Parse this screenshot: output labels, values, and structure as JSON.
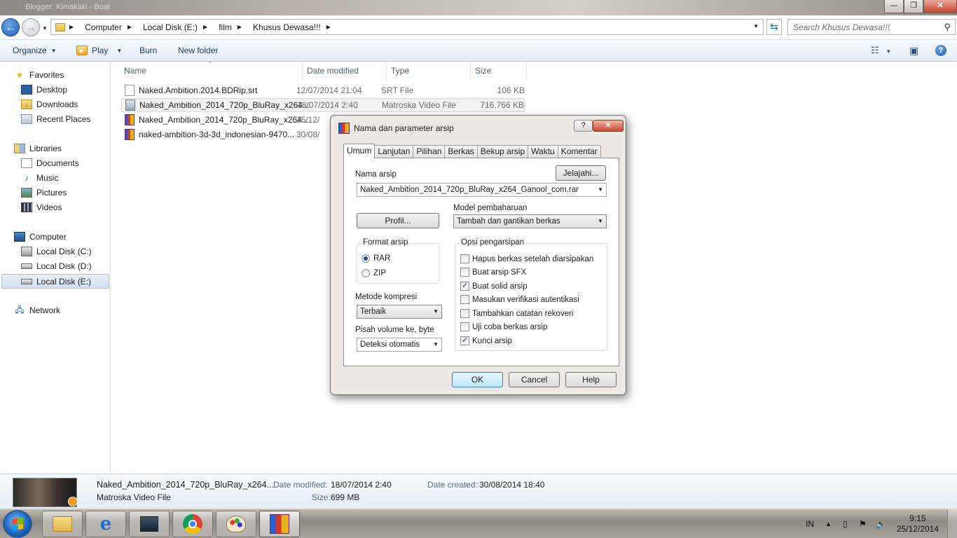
{
  "window": {
    "title_ghost": "Blogger: Kimakaki - Buat"
  },
  "address": {
    "crumbs": [
      "Computer",
      "Local Disk (E:)",
      "film",
      "Khusus Dewasa!!!"
    ],
    "search_placeholder": "Search Khusus Dewasa!!!"
  },
  "toolbar": {
    "organize": "Organize",
    "play": "Play",
    "burn": "Burn",
    "new_folder": "New folder"
  },
  "sidebar": {
    "favorites": "Favorites",
    "desktop": "Desktop",
    "downloads": "Downloads",
    "recent": "Recent Places",
    "libraries": "Libraries",
    "documents": "Documents",
    "music": "Music",
    "pictures": "Pictures",
    "videos": "Videos",
    "computer": "Computer",
    "disk_c": "Local Disk (C:)",
    "disk_d": "Local Disk (D:)",
    "disk_e": "Local Disk (E:)",
    "network": "Network"
  },
  "columns": {
    "name": "Name",
    "date": "Date modified",
    "type": "Type",
    "size": "Size"
  },
  "files": [
    {
      "name": "Naked.Ambition.2014.BDRip.srt",
      "date": "12/07/2014 21:04",
      "type": "SRT File",
      "size": "106 KB",
      "icon": "srt-file-icon"
    },
    {
      "name": "Naked_Ambition_2014_720p_BluRay_x264...",
      "date": "18/07/2014 2:40",
      "type": "Matroska Video File",
      "size": "716,766 KB",
      "icon": "video-file-icon"
    },
    {
      "name": "Naked_Ambition_2014_720p_BluRay_x264...",
      "date": "25/12/",
      "type": "",
      "size": "",
      "icon": "winrar-archive-icon"
    },
    {
      "name": "naked-ambition-3d-3d_indonesian-9470...",
      "date": "30/08/",
      "type": "",
      "size": "",
      "icon": "winrar-archive-icon"
    }
  ],
  "details": {
    "filename": "Naked_Ambition_2014_720p_BluRay_x264...",
    "filetype": "Matroska Video File",
    "modified_label": "Date modified:",
    "modified_value": "18/07/2014 2:40",
    "size_label": "Size:",
    "size_value": "699 MB",
    "created_label": "Date created:",
    "created_value": "30/08/2014 18:40"
  },
  "dialog": {
    "title": "Nama dan parameter arsip",
    "help_btn": "?",
    "tabs": [
      "Umum",
      "Lanjutan",
      "Pilihan",
      "Berkas",
      "Bekup arsip",
      "Waktu",
      "Komentar"
    ],
    "archive_name_label": "Nama arsip",
    "browse_btn": "Jelajahi...",
    "archive_name_value": "Naked_Ambition_2014_720p_BluRay_x264_Ganool_com.rar",
    "profile_btn": "Profil...",
    "update_mode_label": "Model pembaharuan",
    "update_mode_value": "Tambah dan gantikan berkas",
    "format_label": "Format arsip",
    "format_rar": "RAR",
    "format_zip": "ZIP",
    "options_label": "Opsi pengarsipan",
    "options": [
      {
        "label": "Hapus berkas setelah diarsipakan",
        "checked": false
      },
      {
        "label": "Buat arsip SFX",
        "checked": false
      },
      {
        "label": "Buat solid arsip",
        "checked": true
      },
      {
        "label": "Masukan verifikasi autentikasi",
        "checked": false
      },
      {
        "label": "Tambahkan catatan rekoveri",
        "checked": false
      },
      {
        "label": "Uji coba berkas arsip",
        "checked": false
      },
      {
        "label": "Kunci arsip",
        "checked": true
      }
    ],
    "compression_label": "Metode kompresi",
    "compression_value": "Terbaik",
    "split_label": "Pisah volume ke, byte",
    "split_value": "Deteksi otomatis",
    "ok_btn": "OK",
    "cancel_btn": "Cancel",
    "help_text_btn": "Help"
  },
  "taskbar": {
    "lang": "IN",
    "time": "9:15",
    "date": "25/12/2014"
  }
}
